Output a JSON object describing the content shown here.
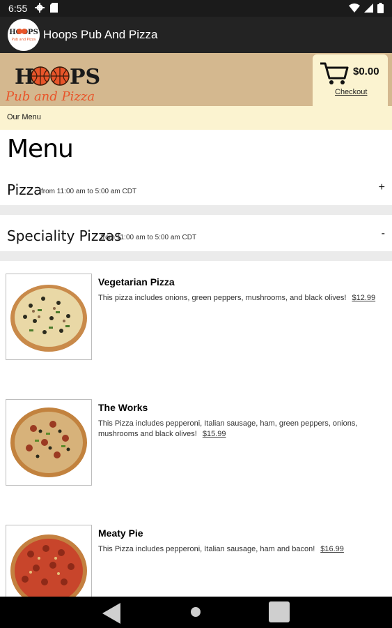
{
  "status_bar": {
    "time": "6:55"
  },
  "app_bar": {
    "title": "Hoops Pub And Pizza",
    "logo_text": "HOOPS"
  },
  "header": {
    "brand_name": "HOOPS",
    "brand_subtitle": "Pub and Pizza",
    "cart_amount": "$0.00",
    "checkout_label": "Checkout"
  },
  "breadcrumb": "Our Menu",
  "page_title": "Menu",
  "categories": [
    {
      "name": "Pizza",
      "hours": "from 11:00 am to 5:00 am CDT",
      "toggle": "+"
    },
    {
      "name": "Speciality Pizzas",
      "hours": "from 11:00 am to 5:00 am CDT",
      "toggle": "-"
    }
  ],
  "items": [
    {
      "name": "Vegetarian Pizza",
      "description": "This pizza includes onions, green peppers, mushrooms, and black olives!",
      "price": "$12.99"
    },
    {
      "name": "The Works",
      "description": "This Pizza includes pepperoni, Italian sausage, ham, green peppers, onions, mushrooms and black olives!",
      "price": "$15.99"
    },
    {
      "name": "Meaty Pie",
      "description": "This Pizza includes pepperoni, Italian sausage, ham and bacon!",
      "price": "$16.99"
    }
  ],
  "colors": {
    "header_tan": "#d4b88f",
    "cream": "#fbf3d0",
    "brand_orange": "#e8552a",
    "app_bar": "#232323"
  }
}
